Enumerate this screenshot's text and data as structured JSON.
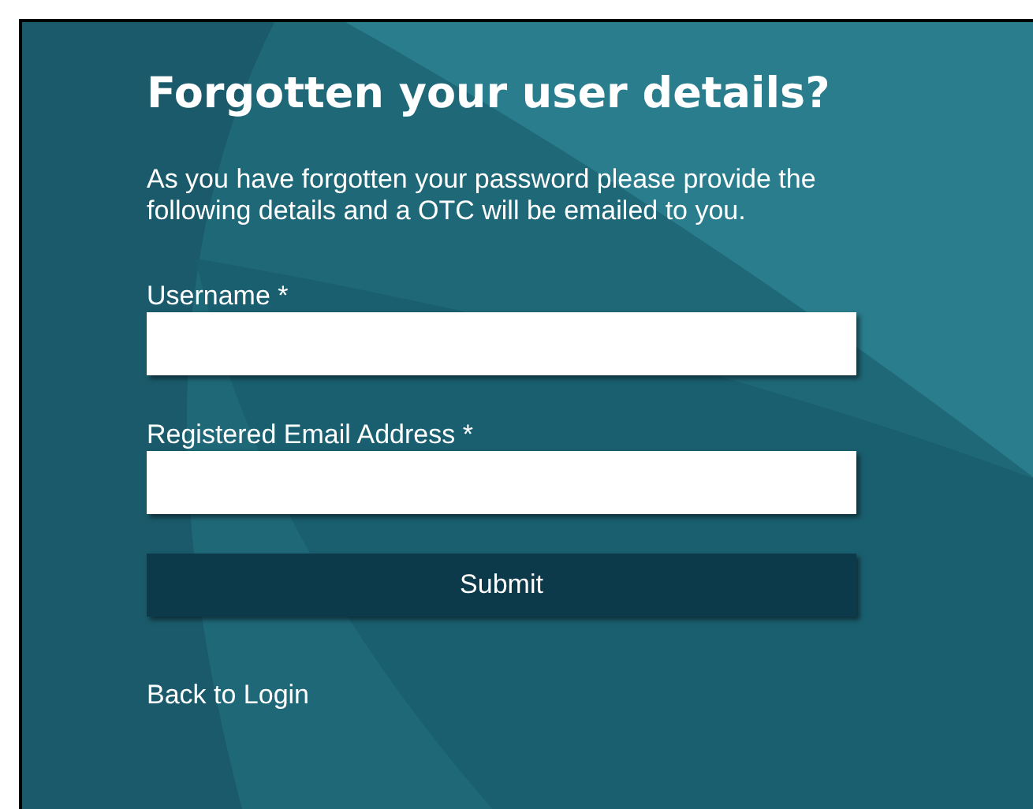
{
  "title": "Forgotten your user details?",
  "intro": "As you have forgotten your password please provide the following details and a OTC will be emailed to you.",
  "fields": [
    {
      "label": "Username *"
    },
    {
      "label": "Registered Email Address *"
    }
  ],
  "submit": "Submit",
  "back_link": "Back to Login"
}
